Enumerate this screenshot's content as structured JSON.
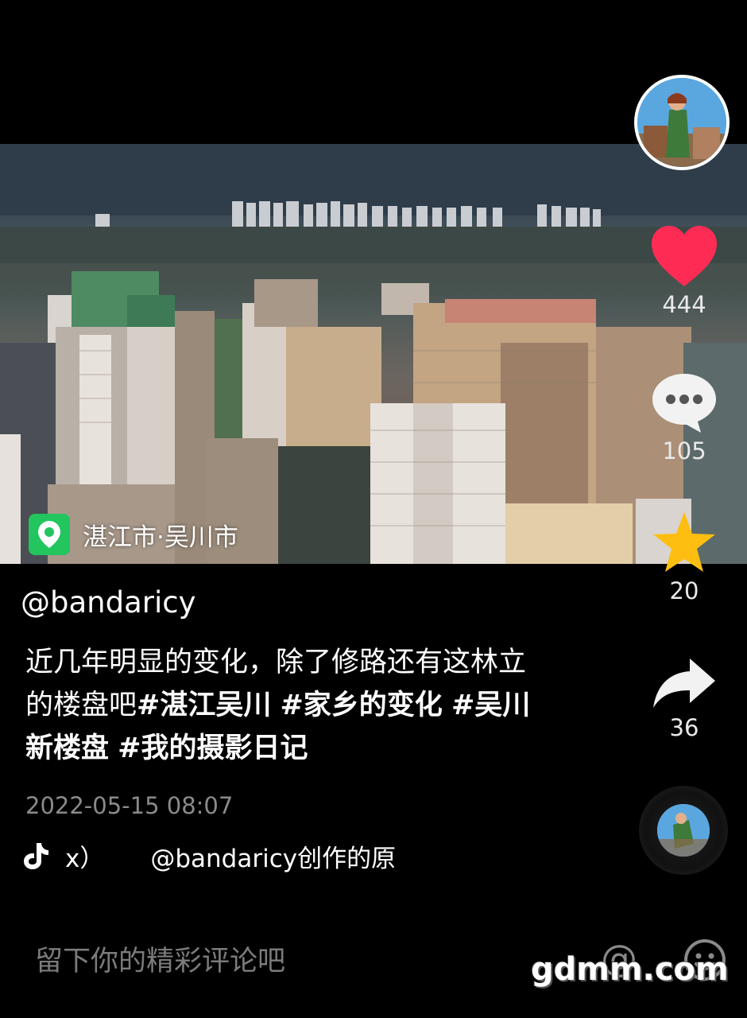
{
  "video": {
    "location_label": "湛江市·吴川市"
  },
  "actions": {
    "like_count": "444",
    "comment_count": "105",
    "favorite_count": "20",
    "share_count": "36"
  },
  "post": {
    "author": "@bandaricy",
    "caption_text": "近几年明显的变化，除了修路还有这林立的楼盘吧",
    "hashtags": [
      "#湛江吴川",
      "#家乡的变化",
      "#吴川新楼盘",
      "#我的摄影日记"
    ],
    "date": "2022-05-15 08:07"
  },
  "music": {
    "prefix": "x）",
    "label": "@bandaricy创作的原"
  },
  "comment_bar": {
    "placeholder": "留下你的精彩评论吧"
  },
  "watermark": "gdmm.com",
  "icons": [
    "location-pin-icon",
    "heart-icon",
    "comment-bubble-icon",
    "star-icon",
    "share-arrow-icon",
    "tiktok-note-icon",
    "at-icon",
    "emoji-icon"
  ],
  "colors": {
    "like": "#fe2c55",
    "favorite": "#fdbe11",
    "location": "#22c55e"
  }
}
